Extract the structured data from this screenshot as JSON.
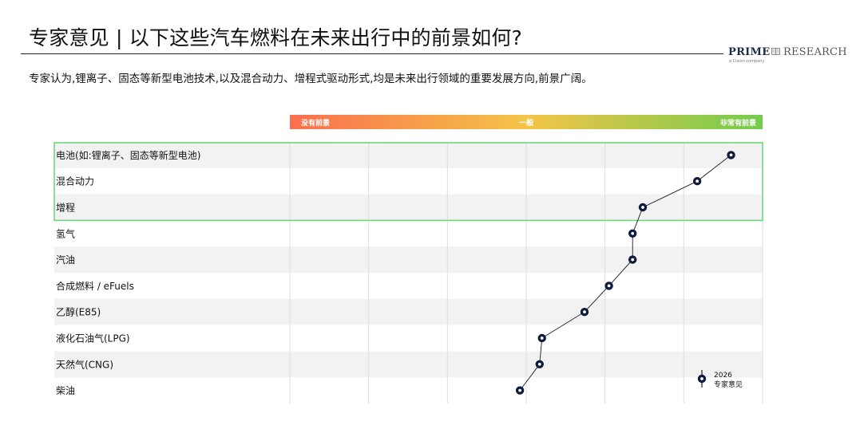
{
  "title": "专家意见 | 以下这些汽车燃料在未来出行中的前景如何?",
  "subtitle": "专家认为,锂离子、固态等新型电池技术,以及混合动力、增程式驱动形式,均是未来出行领域的重要发展方向,前景广阔。",
  "logo": {
    "word1": "PRIME",
    "word2": "RESEARCH",
    "tagline": "a Cision company"
  },
  "colors": {
    "scale_low": "#fa6f4f",
    "scale_mid": "#f5c448",
    "scale_high": "#72cc4d",
    "marker": "#0e1a3e",
    "highlight": "#6fd87a",
    "stripe": "#f2f2f2",
    "grid": "#dddddd"
  },
  "chart_data": {
    "type": "line",
    "orientation": "horizontal",
    "scale_labels": [
      "没有前景",
      "一般",
      "非常有前景"
    ],
    "xlim": [
      0,
      6
    ],
    "categories": [
      "电池(如:锂离子、固态等新型电池)",
      "混合动力",
      "增程",
      "氢气",
      "汽油",
      "合成燃料 / eFuels",
      "乙醇(E85)",
      "液化石油气(LPG)",
      "天然气(CNG)",
      "柴油"
    ],
    "series": [
      {
        "name": "2026 专家意见",
        "values": [
          5.6,
          5.17,
          4.48,
          4.35,
          4.35,
          4.05,
          3.74,
          3.2,
          3.17,
          2.92
        ]
      }
    ],
    "highlighted_categories": [
      "电池(如:锂离子、固态等新型电池)",
      "混合动力",
      "增程"
    ],
    "legend": {
      "label_line1": "2026",
      "label_line2": "专家意见",
      "position": "bottom-right"
    },
    "grid": true
  }
}
